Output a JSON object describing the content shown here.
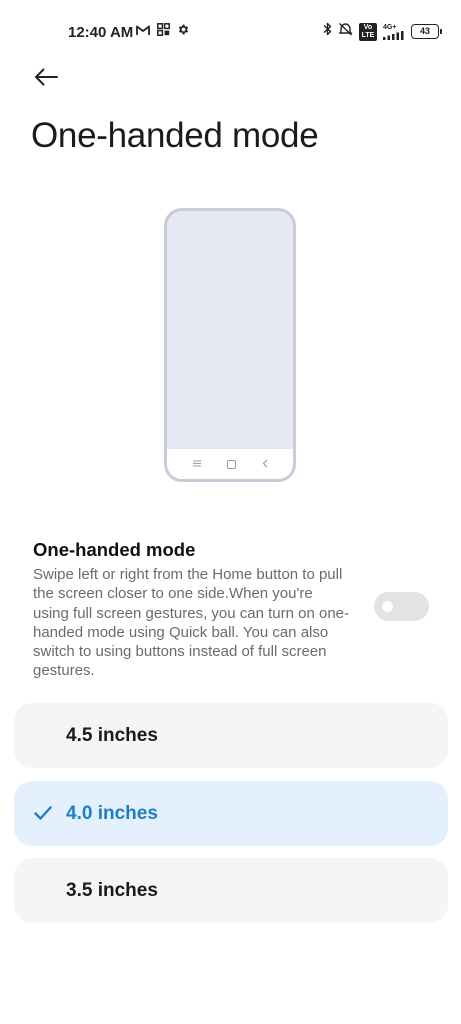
{
  "status_bar": {
    "time": "12:40 AM",
    "battery_level": "43",
    "volte_badge": "Vo LTE",
    "network_type": "4G+",
    "left_icons": [
      "gmail-icon",
      "grid-icon",
      "gear-icon"
    ],
    "right_icons": [
      "bluetooth-icon",
      "silent-icon",
      "volte-icon",
      "signal-icon",
      "battery-icon"
    ]
  },
  "header": {
    "title": "One-handed mode"
  },
  "setting": {
    "title": "One-handed mode",
    "description": "Swipe left or right from the Home button to pull the screen closer to one side.When you're using full screen gestures, you can turn on one-handed mode using Quick ball. You can also switch to using buttons instead of full screen gestures.",
    "toggle_enabled": false
  },
  "options": [
    {
      "label": "4.5 inches",
      "selected": false
    },
    {
      "label": "4.0 inches",
      "selected": true
    },
    {
      "label": "3.5 inches",
      "selected": false
    }
  ],
  "colors": {
    "accent": "#1d7fc6",
    "selected_background": "#e4f1fc",
    "option_background": "#f5f5f5",
    "phone_frame": "#c9cbdb",
    "phone_screen": "#e6e8f4"
  }
}
